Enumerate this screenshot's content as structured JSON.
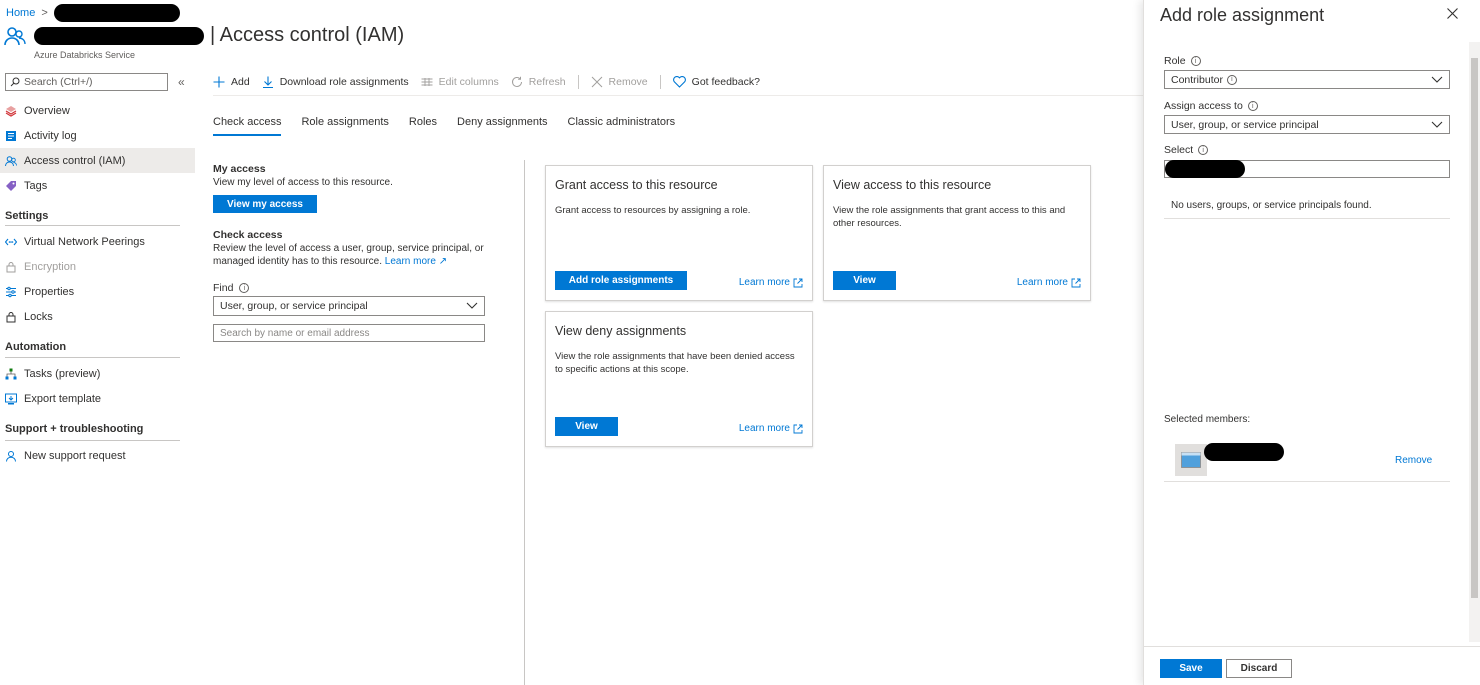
{
  "header": {
    "breadcrumb_home": "Home",
    "title": "Access control (IAM)",
    "subtitle": "Azure Databricks Service"
  },
  "sidebar": {
    "search_placeholder": "Search (Ctrl+/)",
    "items": [
      {
        "label": "Overview",
        "icon": "overview-icon"
      },
      {
        "label": "Activity log",
        "icon": "activity-log-icon"
      },
      {
        "label": "Access control (IAM)",
        "icon": "people-icon",
        "active": true
      },
      {
        "label": "Tags",
        "icon": "tag-icon"
      }
    ],
    "sections": {
      "settings": "Settings",
      "automation": "Automation",
      "support": "Support + troubleshooting"
    },
    "settings_items": [
      {
        "label": "Virtual Network Peerings",
        "icon": "peering-icon"
      },
      {
        "label": "Encryption",
        "icon": "lock-icon",
        "disabled": true
      },
      {
        "label": "Properties",
        "icon": "properties-icon"
      },
      {
        "label": "Locks",
        "icon": "lock-icon"
      }
    ],
    "automation_items": [
      {
        "label": "Tasks (preview)",
        "icon": "tasks-icon"
      },
      {
        "label": "Export template",
        "icon": "export-icon"
      }
    ],
    "support_items": [
      {
        "label": "New support request",
        "icon": "support-icon"
      }
    ]
  },
  "toolbar": {
    "add": "Add",
    "download": "Download role assignments",
    "edit_columns": "Edit columns",
    "refresh": "Refresh",
    "remove": "Remove",
    "feedback": "Got feedback?"
  },
  "tabs": [
    "Check access",
    "Role assignments",
    "Roles",
    "Deny assignments",
    "Classic administrators"
  ],
  "check": {
    "my_access_title": "My access",
    "my_access_desc": "View my level of access to this resource.",
    "view_my_access": "View my access",
    "check_access_title": "Check access",
    "check_access_desc": "Review the level of access a user, group, service principal, or managed identity has to this resource.",
    "learn_more": "Learn more",
    "find_label": "Find",
    "find_value": "User, group, or service principal",
    "search_placeholder": "Search by name or email address"
  },
  "cards": {
    "grant": {
      "title": "Grant access to this resource",
      "desc": "Grant access to resources by assigning a role.",
      "button": "Add role assignments",
      "link": "Learn more"
    },
    "view": {
      "title": "View access to this resource",
      "desc": "View the role assignments that grant access to this and other resources.",
      "button": "View",
      "link": "Learn more"
    },
    "deny": {
      "title": "View deny assignments",
      "desc": "View the role assignments that have been denied access to specific actions at this scope.",
      "button": "View",
      "link": "Learn more"
    }
  },
  "panel": {
    "title": "Add role assignment",
    "role_label": "Role",
    "role_value": "Contributor",
    "assign_label": "Assign access to",
    "assign_value": "User, group, or service principal",
    "select_label": "Select",
    "no_results": "No users, groups, or service principals found.",
    "selected_members": "Selected members:",
    "remove": "Remove",
    "save": "Save",
    "discard": "Discard"
  },
  "colors": {
    "accent": "#0078d4",
    "text": "#323130",
    "disabled": "#a19f9d"
  }
}
